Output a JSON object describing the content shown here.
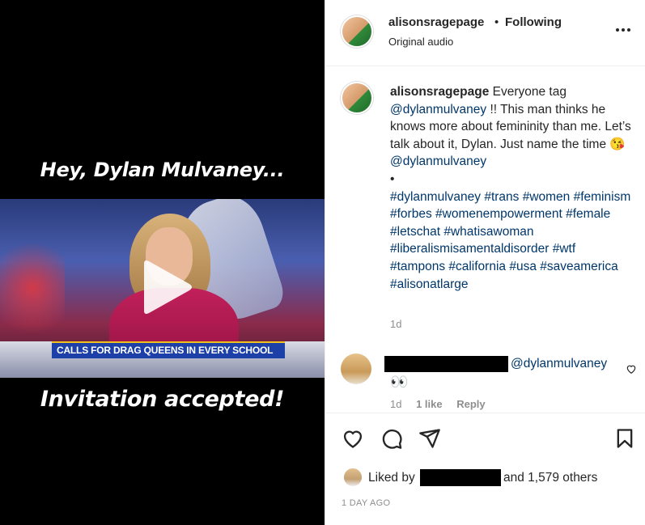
{
  "video": {
    "caption_top": "Hey, Dylan Mulvaney...",
    "caption_bottom": "Invitation accepted!",
    "lower_third": "CALLS FOR DRAG QUEENS IN EVERY SCHOOL"
  },
  "header": {
    "username": "alisonsragepage",
    "separator": "•",
    "following": "Following",
    "audio": "Original audio"
  },
  "caption": {
    "username": "alisonsragepage",
    "text_1": "Everyone tag",
    "mention_1": "@dylanmulvaney",
    "text_2": "!! This man thinks he knows more about femininity than me. Let’s talk about it, Dylan. Just name the time",
    "emoji": "😘",
    "mention_2": "@dylanmulvaney",
    "bullet": "•",
    "hashtags": "#dylanmulvaney #trans #women #feminism #forbes #womenempowerment #female #letschat #whatisawoman #liberalismisamentaldisorder #wtf #tampons #california #usa #saveamerica #alisonatlarge",
    "time": "1d"
  },
  "comment": {
    "mention": "@dylanmulvaney",
    "text": "👀",
    "time": "1d",
    "likes": "1 like",
    "reply": "Reply"
  },
  "likes": {
    "prefix": "Liked by",
    "suffix": "and 1,579 others"
  },
  "posted": "1 DAY AGO",
  "colors": {
    "link": "#00376b",
    "secondary_text": "#8e8e8e",
    "border": "#efefef"
  }
}
